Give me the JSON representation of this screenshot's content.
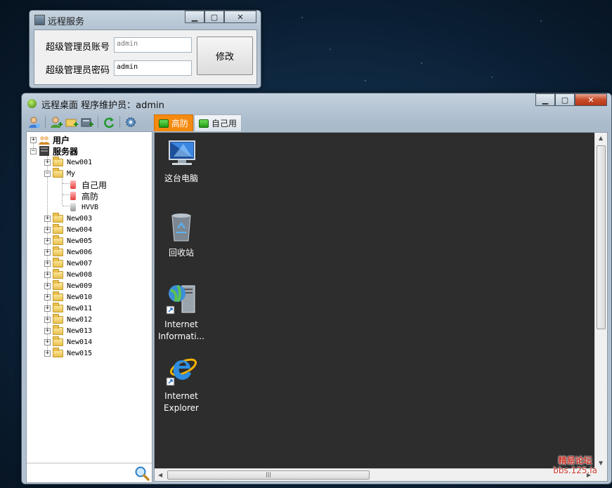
{
  "dialog": {
    "title": "远程服务",
    "account_label": "超级管理员账号",
    "account_value": "admin",
    "password_label": "超级管理员密码",
    "password_value": "admin",
    "edit_button": "修改"
  },
  "window": {
    "title": "远程桌面  程序维护员：admin",
    "minimize": "▁",
    "maximize": "▢",
    "close": "✕"
  },
  "toolbar": [
    "user-icon",
    "add-user-icon",
    "add-folder-icon",
    "add-server-icon",
    "refresh-icon",
    "settings-icon"
  ],
  "tree": {
    "users": "用户",
    "servers": "服务器",
    "groups": [
      {
        "label": "New001",
        "expanded": false
      },
      {
        "label": "My",
        "expanded": true,
        "children": [
          "自己用",
          "高防",
          "HVVB"
        ]
      },
      {
        "label": "New003"
      },
      {
        "label": "New004"
      },
      {
        "label": "New005"
      },
      {
        "label": "New006"
      },
      {
        "label": "New007"
      },
      {
        "label": "New008"
      },
      {
        "label": "New009"
      },
      {
        "label": "New010"
      },
      {
        "label": "New011"
      },
      {
        "label": "New012"
      },
      {
        "label": "New013"
      },
      {
        "label": "New014"
      },
      {
        "label": "New015"
      }
    ]
  },
  "tabs": [
    {
      "label": "高防",
      "active": true
    },
    {
      "label": "自己用",
      "active": false
    }
  ],
  "desktop": {
    "icons": [
      {
        "name": "这台电脑",
        "line2": "",
        "icon": "computer-icon"
      },
      {
        "name": "回收站",
        "line2": "",
        "icon": "recycle-bin-icon"
      },
      {
        "name": "Internet",
        "line2": "Informati...",
        "icon": "iis-manager-icon"
      },
      {
        "name": "Internet",
        "line2": "Explorer",
        "icon": "internet-explorer-icon"
      }
    ]
  },
  "watermark": {
    "line1": "精易论坛",
    "line2": "bbs.125.la"
  },
  "colors": {
    "active_tab": "#f58a10",
    "desktop_bg": "#2d2d2d"
  }
}
